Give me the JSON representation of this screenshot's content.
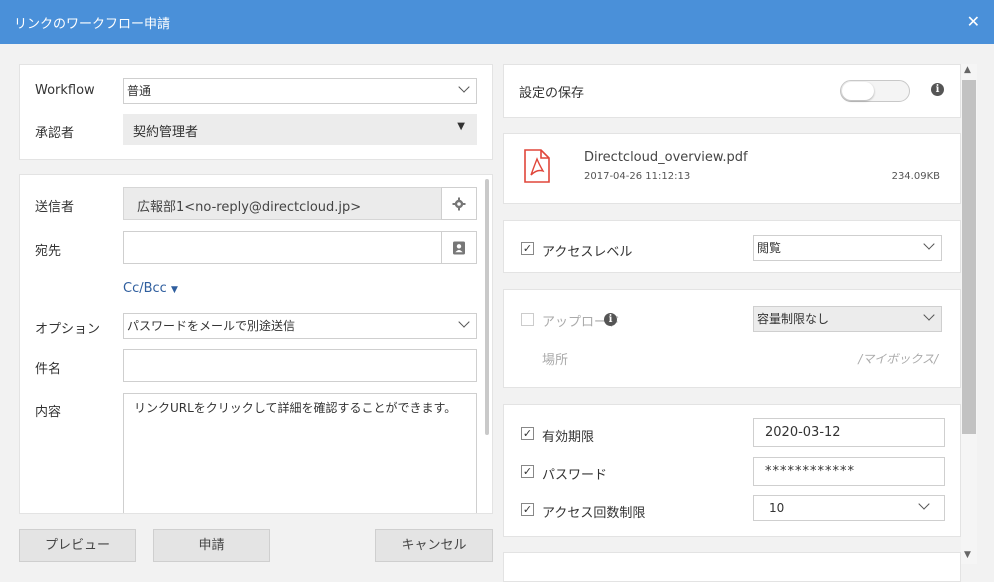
{
  "dialog": {
    "title": "リンクのワークフロー申請",
    "close_glyph": "✕"
  },
  "workflow": {
    "label": "Workflow",
    "value": "普通",
    "approver_label": "承認者",
    "approver_value": "契約管理者"
  },
  "form": {
    "sender_label": "送信者",
    "sender_value": "広報部1<no-reply@directcloud.jp>",
    "to_label": "宛先",
    "to_value": "",
    "ccbcc_label": "Cc/Bcc",
    "option_label": "オプション",
    "option_value": "パスワードをメールで別途送信",
    "subject_label": "件名",
    "subject_value": "",
    "body_label": "内容",
    "body_value": "リンクURLをクリックして詳細を確認することができます。"
  },
  "buttons": {
    "preview": "プレビュー",
    "submit": "申請",
    "cancel": "キャンセル"
  },
  "settings": {
    "save_label": "設定の保存",
    "save_toggle_on": false,
    "file": {
      "name": "Directcloud_overview.pdf",
      "date": "2017-04-26 11:12:13",
      "size": "234.09KB"
    },
    "access_level": {
      "label": "アクセスレベル",
      "checked": true,
      "value": "閲覧"
    },
    "upload": {
      "label": "アップロード",
      "checked": false,
      "value": "容量制限なし"
    },
    "location": {
      "label": "場所",
      "value": "/マイボックス/"
    },
    "expiry": {
      "label": "有効期限",
      "checked": true,
      "value": "2020-03-12"
    },
    "password": {
      "label": "パスワード",
      "checked": true,
      "value": "************"
    },
    "access_count": {
      "label": "アクセス回数制限",
      "checked": true,
      "value": "10"
    }
  },
  "colors": {
    "titlebar": "#4a90d9",
    "link": "#2f5e9e",
    "pdf_red": "#e0463a"
  }
}
